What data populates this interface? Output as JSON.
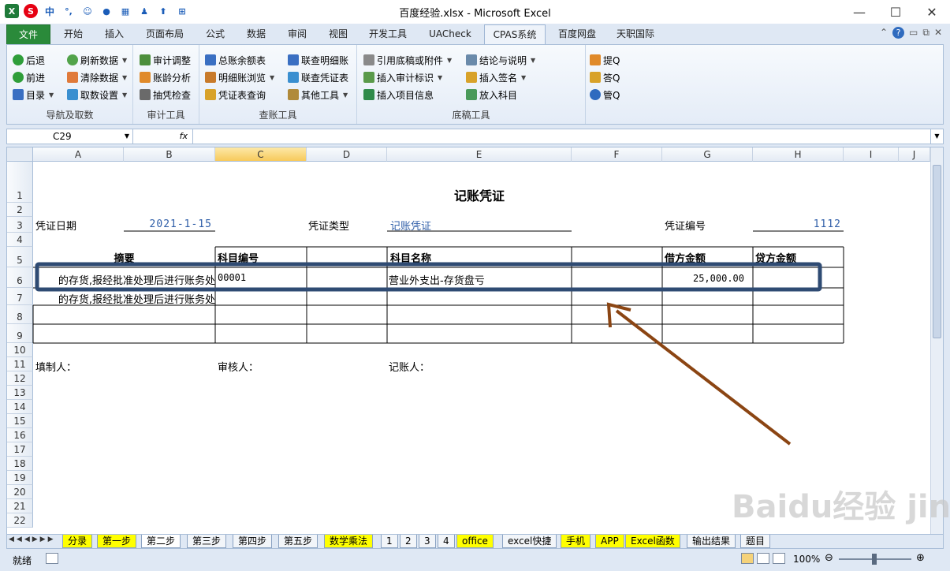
{
  "window": {
    "title": "百度经验.xlsx - Microsoft Excel",
    "minimize": "—",
    "restore": "☐",
    "close": "✕"
  },
  "ribbon_tabs": [
    "文件",
    "开始",
    "插入",
    "页面布局",
    "公式",
    "数据",
    "审阅",
    "视图",
    "开发工具",
    "UACheck",
    "CPAS系统",
    "百度网盘",
    "天职国际"
  ],
  "groups": {
    "nav": {
      "label": "导航及取数",
      "items": [
        "后退",
        "前进",
        "目录",
        "刷新数据",
        "清除数据",
        "取数设置"
      ]
    },
    "audit": {
      "label": "审计工具",
      "items": [
        "审计调整",
        "账龄分析",
        "抽凭检查"
      ]
    },
    "ledger": {
      "label": "查账工具",
      "items": [
        "总账余额表",
        "明细账浏览",
        "凭证表查询",
        "联查明细账",
        "联查凭证表",
        "其他工具"
      ]
    },
    "draft": {
      "label": "底稿工具",
      "items": [
        "引用底稿或附件",
        "插入审计标识",
        "插入项目信息",
        "结论与说明",
        "插入签名",
        "放入科目"
      ]
    },
    "q": {
      "items": [
        "提Q",
        "答Q",
        "管Q"
      ]
    }
  },
  "formula_bar": {
    "name_box": "C29",
    "fx": "fx"
  },
  "columns": [
    "A",
    "B",
    "C",
    "D",
    "E",
    "F",
    "G",
    "H",
    "I",
    "J"
  ],
  "rows": [
    "1",
    "2",
    "3",
    "4",
    "5",
    "6",
    "7",
    "8",
    "9",
    "10",
    "11",
    "12",
    "13",
    "14",
    "15",
    "16",
    "17",
    "18",
    "19",
    "20",
    "21",
    "22"
  ],
  "sheet": {
    "title": "记账凭证",
    "date_label": "凭证日期",
    "date_value": "2021-1-15",
    "type_label": "凭证类型",
    "type_value": "记账凭证",
    "number_label": "凭证编号",
    "number_value": "1112",
    "headers": {
      "summary": "摘要",
      "account_code": "科目编号",
      "account_name": "科目名称",
      "debit": "借方金额",
      "credit": "贷方金额"
    },
    "row6": {
      "summary": "的存货,报经批准处理后进行账务处",
      "prefix": "的",
      "account_code": "00001",
      "account_name": "营业外支出-存货盘亏",
      "debit": "25,000.00"
    },
    "row7": {
      "summary": "的存货,报经批准处理后进行账务处"
    },
    "prepared_by": "填制人：",
    "reviewed_by": "审核人：",
    "posted_by": "记账人："
  },
  "sheet_tabs": [
    "分录",
    "第一步",
    "第二步",
    "第三步",
    "第四步",
    "第五步",
    "数学乘法",
    "1",
    "2",
    "3",
    "4",
    "office",
    "excel快捷",
    "手机",
    "APP",
    "Excel函数",
    "输出结果",
    "题目"
  ],
  "active_sheet": "第二步",
  "status": {
    "ready": "就绪",
    "zoom": "100%"
  },
  "watermark": "Baidu经验 jingyan.baidu.com",
  "colors": {
    "highlight_box": "#2f4b73",
    "arrow": "#8b4513",
    "file_tab": "#2a8a3a"
  }
}
